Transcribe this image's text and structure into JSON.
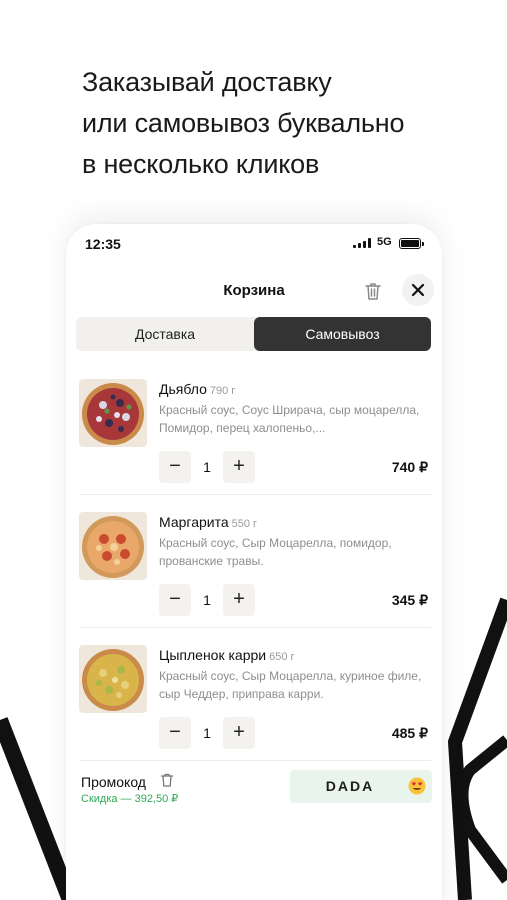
{
  "headline": {
    "lines": [
      "Заказывай доставку",
      "или самовывоз буквально",
      "в несколько кликов"
    ]
  },
  "status_bar": {
    "time": "12:35",
    "network": "5G",
    "icons": [
      "signal-icon",
      "battery-icon"
    ]
  },
  "cart": {
    "title": "Корзина",
    "icons": [
      "trash-icon",
      "close-icon"
    ],
    "tabs": [
      {
        "label": "Доставка",
        "selected": false
      },
      {
        "label": "Самовывоз",
        "selected": true
      }
    ],
    "items": [
      {
        "name": "Дьябло",
        "weight": "790 г",
        "description": "Красный соус, Соус Шрирача, сыр моцарелла, Помидор, перец халопеньо,...",
        "quantity": "1",
        "price": "740 ₽"
      },
      {
        "name": "Маргарита",
        "weight": "550 г",
        "description": "Красный соус, Сыр Моцарелла, помидор, прованские травы.",
        "quantity": "1",
        "price": "345 ₽"
      },
      {
        "name": "Цыпленок карри",
        "weight": "650 г",
        "description": "Красный соус, Сыр Моцарелла, куриное филе, сыр Чеддер, приправа карри.",
        "quantity": "1",
        "price": "485 ₽"
      }
    ],
    "qty_minus": "−",
    "qty_plus": "+",
    "promo": {
      "label": "Промокод",
      "discount": "Скидка — 392,50 ₽",
      "code": "DADA",
      "code_icon": "heart-eyes-emoji-icon"
    }
  },
  "colors": {
    "selected_tab": "#333333",
    "tab_bg": "#f1f0ec",
    "discount": "#2fa956",
    "promo_bg": "#e8f4ec"
  }
}
